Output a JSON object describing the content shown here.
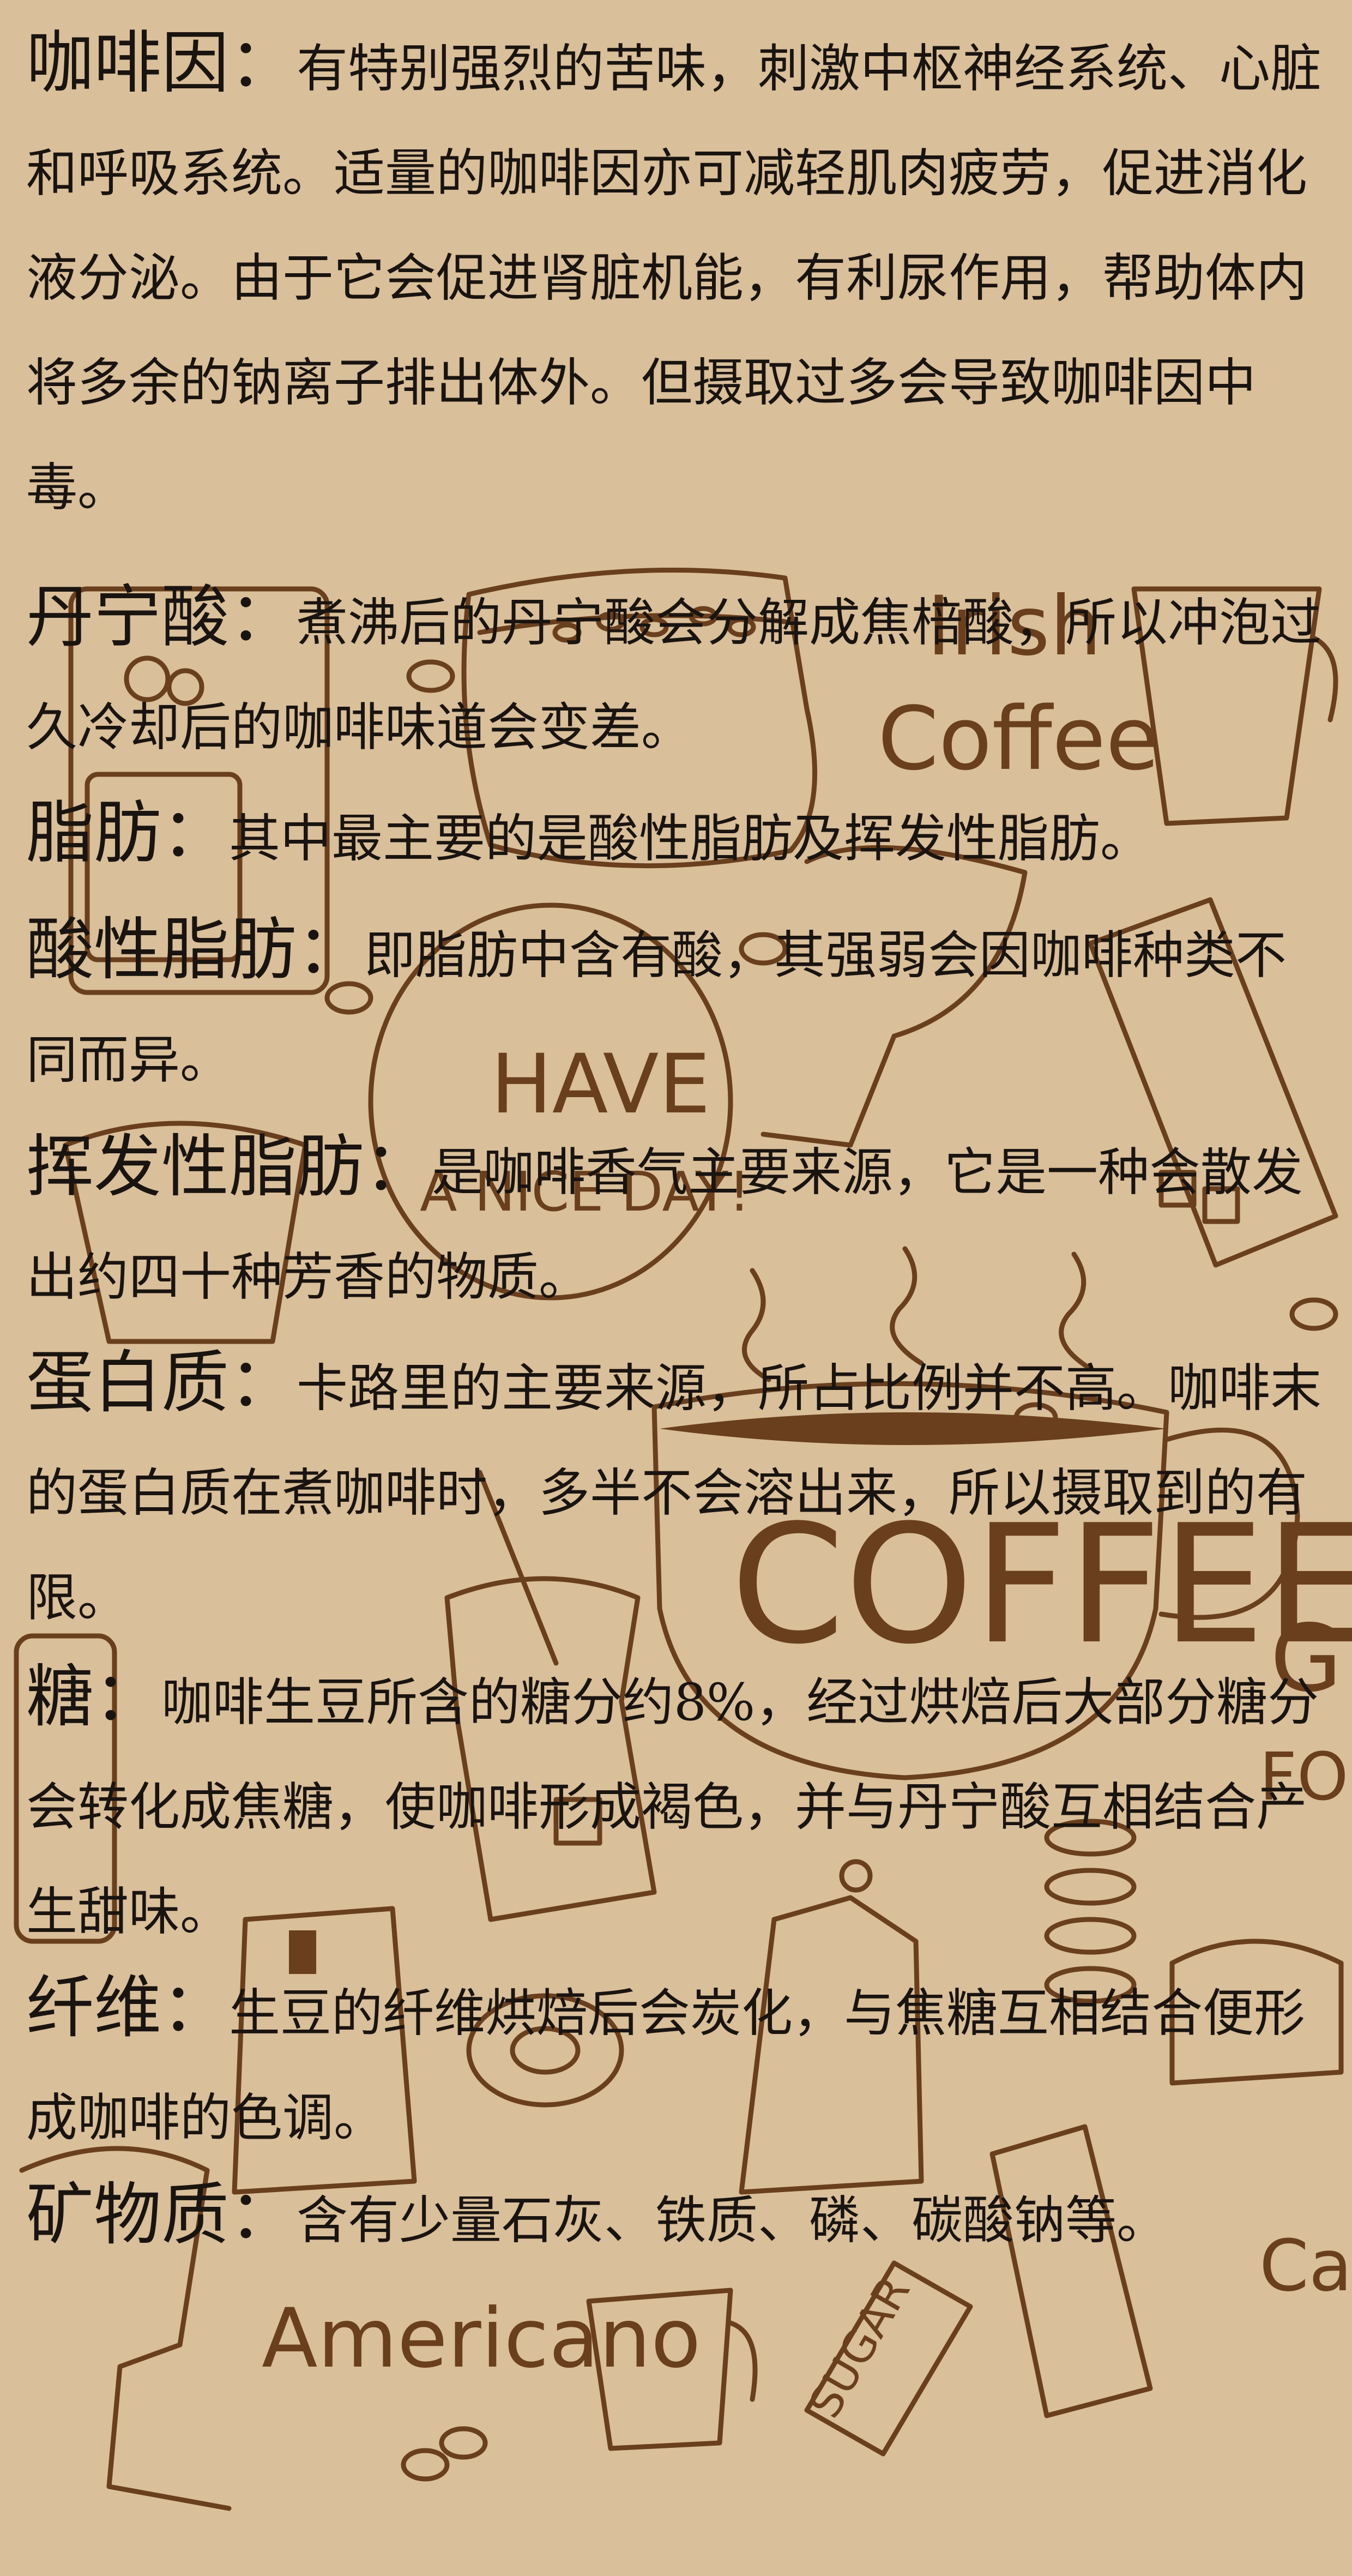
{
  "entries": [
    {
      "term": "咖啡因",
      "colon": "：",
      "text": "有特别强烈的苦味，刺激中枢神经系统、心脏和呼吸系统。适量的咖啡因亦可减轻肌肉疲劳，促进消化液分泌。由于它会促进肾脏机能，有利尿作用，帮助体内将多余的钠离子排出体外。但摄取过多会导致咖啡因中毒。"
    },
    {
      "term": "丹宁酸",
      "colon": "：",
      "text": "煮沸后的丹宁酸会分解成焦棓酸，所以冲泡过久冷却后的咖啡味道会变差。"
    },
    {
      "term": "脂肪",
      "colon": "：",
      "text": "其中最主要的是酸性脂肪及挥发性脂肪。"
    },
    {
      "term": "酸性脂肪",
      "colon": "：",
      "text": "即脂肪中含有酸，其强弱会因咖啡种类不同而异。"
    },
    {
      "term": "挥发性脂肪",
      "colon": "：",
      "text": "是咖啡香气主要来源，它是一种会散发出约四十种芳香的物质。"
    },
    {
      "term": "蛋白质",
      "colon": "：",
      "text": "卡路里的主要来源，所占比例并不高。咖啡末的蛋白质在煮咖啡时，多半不会溶出来，所以摄取到的有限。"
    },
    {
      "term": "糖",
      "colon": "：",
      "text": "咖啡生豆所含的糖分约8%，经过烘焙后大部分糖分会转化成焦糖，使咖啡形成褐色，并与丹宁酸互相结合产生甜味。"
    },
    {
      "term": "纤维",
      "colon": "：",
      "text": "生豆的纤维烘焙后会炭化，与焦糖互相结合便形成咖啡的色调。"
    },
    {
      "term": "矿物质",
      "colon": "：",
      "text": "含有少量石灰、铁质、磷、碳酸钠等。"
    }
  ],
  "background": {
    "color": "#d9bf9a",
    "line_color": "#6a3f1e",
    "lettering": [
      "Irish",
      "Coffee",
      "HAVE",
      "A NICE DAY!",
      "COFFEE",
      "Americano",
      "SUGAR",
      "Cap",
      "G",
      "FO"
    ]
  }
}
